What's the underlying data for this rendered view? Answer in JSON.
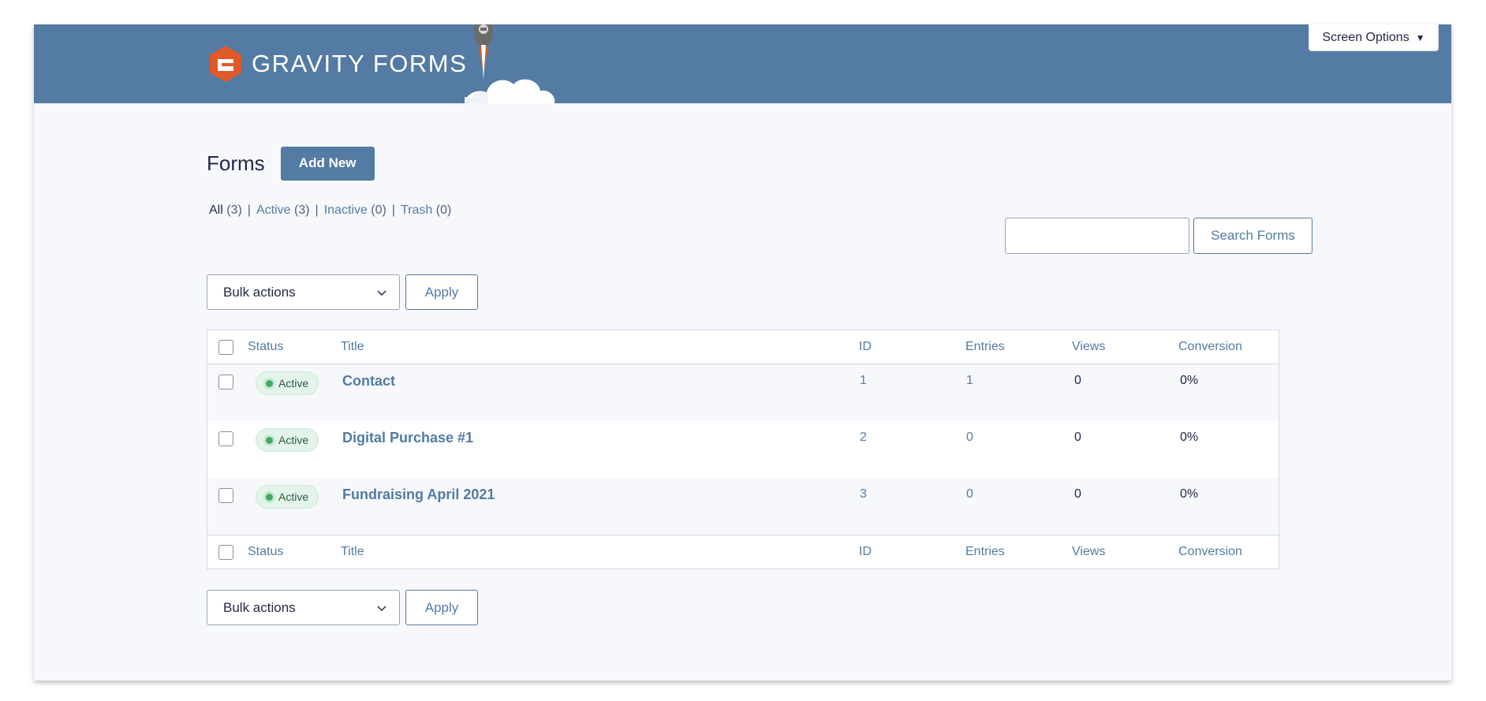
{
  "header": {
    "brand": "GRAVITY FORMS",
    "screen_options": "Screen Options"
  },
  "page": {
    "title": "Forms",
    "add_new": "Add New"
  },
  "filters": [
    {
      "label": "All",
      "count": "(3)"
    },
    {
      "label": "Active",
      "count": "(3)"
    },
    {
      "label": "Inactive",
      "count": "(0)"
    },
    {
      "label": "Trash",
      "count": "(0)"
    }
  ],
  "search": {
    "button": "Search Forms",
    "value": ""
  },
  "bulk": {
    "select_label": "Bulk actions",
    "apply": "Apply"
  },
  "table": {
    "columns": [
      "Status",
      "Title",
      "ID",
      "Entries",
      "Views",
      "Conversion"
    ],
    "rows": [
      {
        "status": "Active",
        "title": "Contact",
        "id": "1",
        "entries": "1",
        "views": "0",
        "conversion": "0%"
      },
      {
        "status": "Active",
        "title": "Digital Purchase #1",
        "id": "2",
        "entries": "0",
        "views": "0",
        "conversion": "0%"
      },
      {
        "status": "Active",
        "title": "Fundraising April 2021",
        "id": "3",
        "entries": "0",
        "views": "0",
        "conversion": "0%"
      }
    ]
  },
  "colors": {
    "header_bg": "#537ba3",
    "accent": "#537ba3",
    "logo_orange": "#e0592a",
    "active_green": "#46a766",
    "page_bg": "#f6f8fc"
  }
}
